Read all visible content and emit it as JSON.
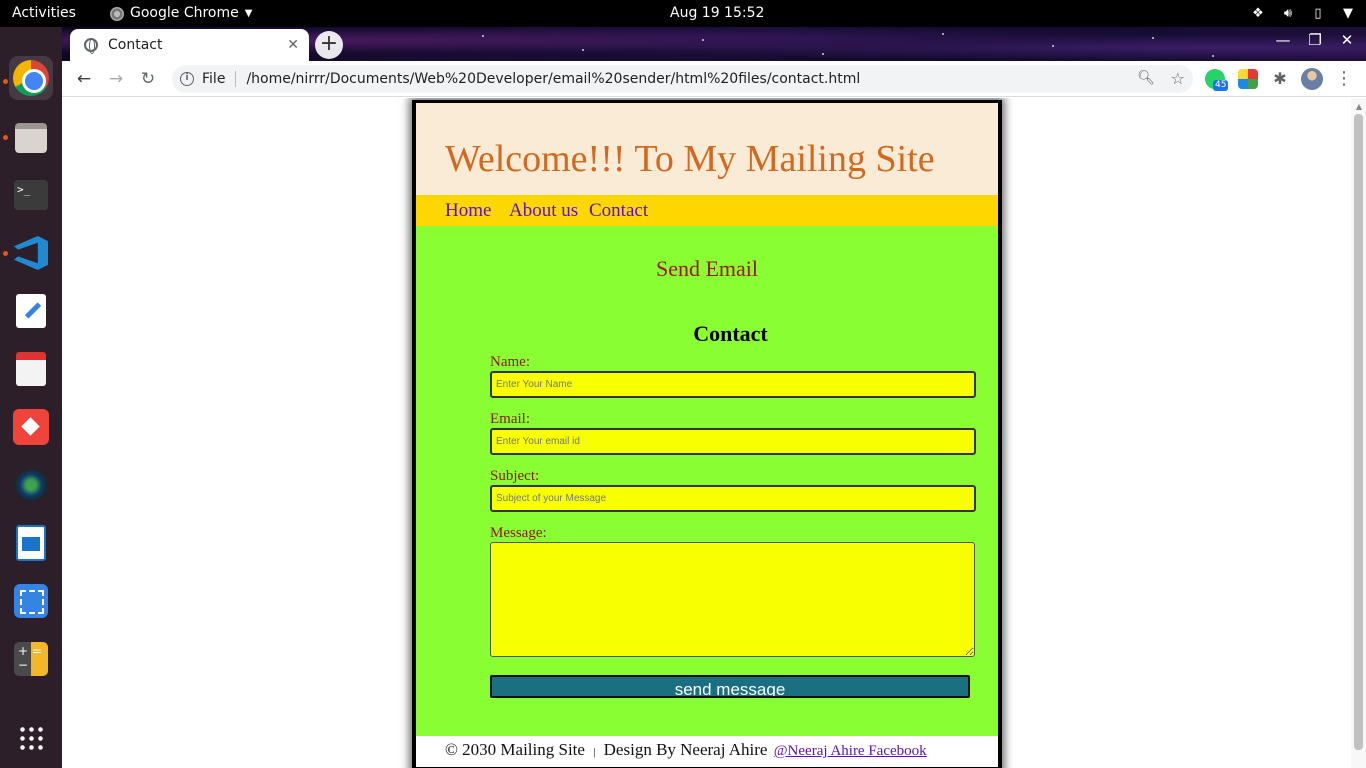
{
  "topbar": {
    "activities": "Activities",
    "app_name": "Google Chrome",
    "clock": "Aug 19  15:52"
  },
  "browser": {
    "tab_title": "Contact",
    "scheme_label": "File",
    "url": "/home/nirrr/Documents/Web%20Developer/email%20sender/html%20files/contact.html",
    "extension_badge": "45"
  },
  "page": {
    "site_title": "Welcome!!! To My Mailing Site",
    "nav": [
      "Home",
      "About us",
      "Contact"
    ],
    "send_email_heading": "Send Email",
    "contact_heading": "Contact",
    "form": {
      "name_label": "Name:",
      "name_placeholder": "Enter Your Name",
      "email_label": "Email:",
      "email_placeholder": "Enter Your email id",
      "subject_label": "Subject:",
      "subject_placeholder": "Subject of your Message",
      "message_label": "Message:",
      "message_value": "",
      "submit_label": "send message"
    },
    "footer": {
      "copyright": "© 2030 Mailing Site",
      "separator": "|",
      "designer": "Design By Neeraj Ahire",
      "link": "@Neeraj Ahire Facebook"
    }
  },
  "colors": {
    "header_bg": "#faebd7",
    "title_color": "#d2691e",
    "nav_bg": "#ffd700",
    "link_color": "#5a0fd1",
    "main_bg": "#89ff33",
    "input_bg": "#f7ff00",
    "button_bg": "#1a7080"
  }
}
